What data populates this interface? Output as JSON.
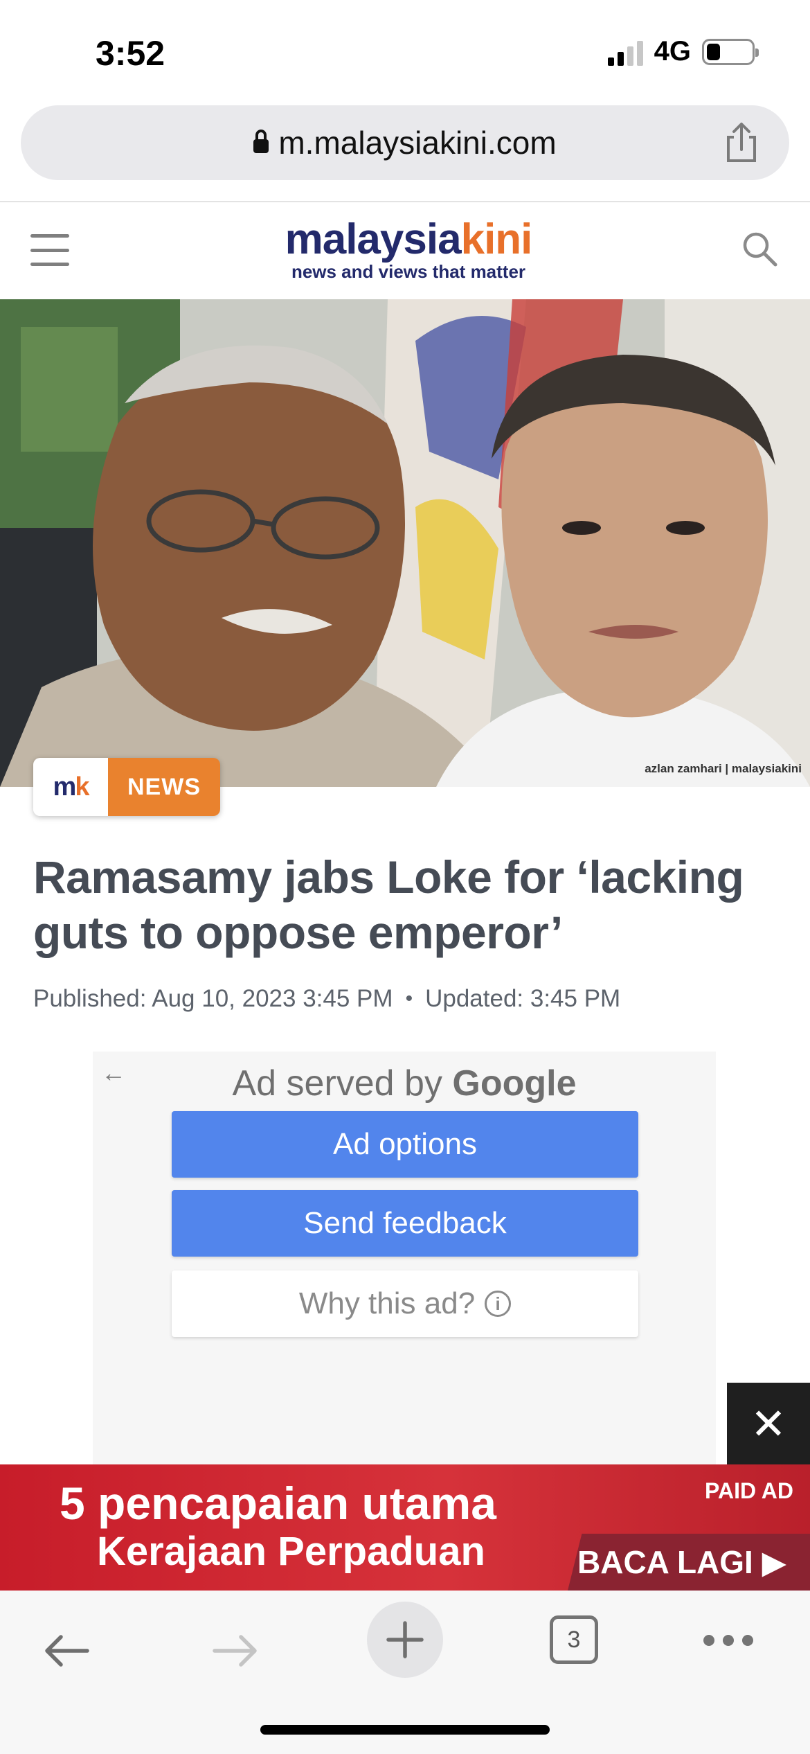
{
  "status_bar": {
    "time": "3:52",
    "network": "4G",
    "battery_level": 0.3
  },
  "browser": {
    "url": "m.malaysiakini.com",
    "tab_count": "3",
    "icons": [
      "lock-icon",
      "share-icon",
      "back-arrow-icon",
      "forward-arrow-icon",
      "plus-icon",
      "more-icon"
    ]
  },
  "site": {
    "logo_primary": "malaysia",
    "logo_accent": "kini",
    "tagline": "news and views that matter",
    "brand_colors": {
      "navy": "#232a6b",
      "orange": "#e8702a"
    }
  },
  "article": {
    "photo_credit": "azlan zamhari | malaysiakini",
    "badge_logo_m": "m",
    "badge_logo_k": "k",
    "category": "NEWS",
    "headline": "Ramasamy jabs Loke for ‘lacking guts to oppose emperor’",
    "published": "Published:  Aug 10, 2023 3:45 PM",
    "separator": "•",
    "updated": "Updated: 3:45 PM"
  },
  "ad": {
    "served_by": "Ad served by",
    "served_brand": "Google",
    "options_label": "Ad options",
    "feedback_label": "Send feedback",
    "why_label": "Why this ad?",
    "info_symbol": "i",
    "back_symbol": "←",
    "close_symbol": "✕",
    "button_color": "#5285ec"
  },
  "banner": {
    "line1": "5 pencapaian utama",
    "line2": "Kerajaan Perpaduan",
    "paid_label": "PAID AD",
    "cta": "BACA LAGI ▶"
  }
}
